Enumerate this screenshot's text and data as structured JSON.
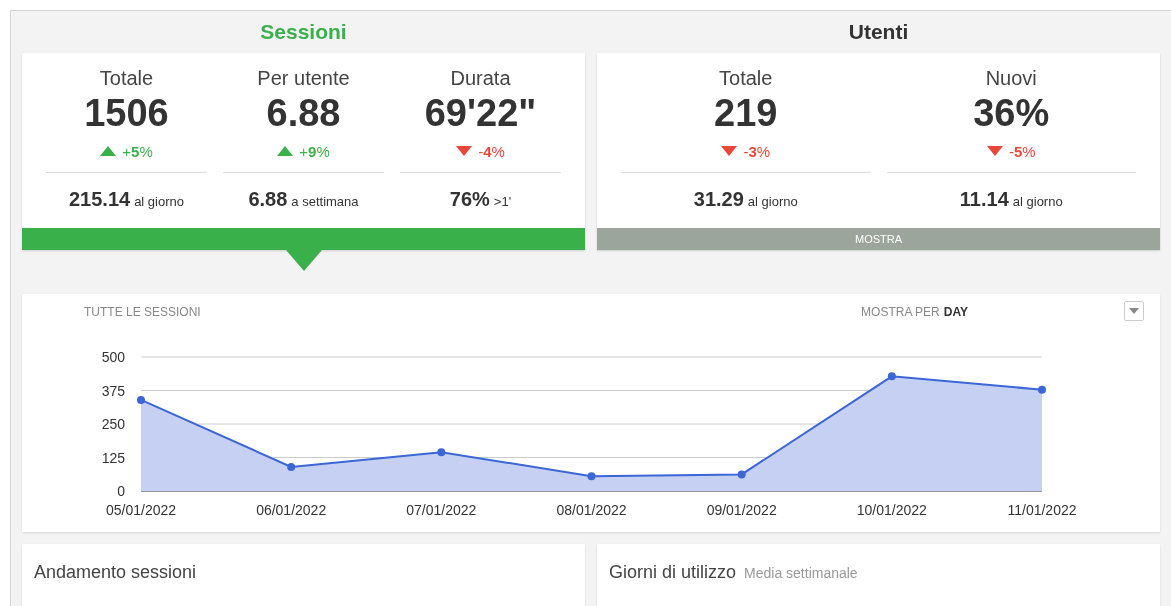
{
  "groups": [
    {
      "title": "Sessioni",
      "selected": true,
      "metrics": [
        {
          "label": "Totale",
          "value": "1506",
          "rising": true,
          "delta": "+**5**%",
          "sub_value": "215.14",
          "sub_label": "al giorno"
        },
        {
          "label": "Per utente",
          "value": "6.88",
          "rising": true,
          "delta": "+**9**%",
          "sub_value": "6.88",
          "sub_label": "a settimana"
        },
        {
          "label": "Durata",
          "value": "69'22\"",
          "rising": false,
          "delta": "-**4**%",
          "sub_value": "76%",
          "sub_label": ">1'"
        }
      ]
    },
    {
      "title": "Utenti",
      "selected": false,
      "footer": "MOSTRA",
      "metrics": [
        {
          "label": "Totale",
          "value": "219",
          "rising": false,
          "delta": "-**3**%",
          "sub_value": "31.29",
          "sub_label": "al giorno"
        },
        {
          "label": "Nuovi",
          "value": "36%",
          "rising": false,
          "delta": "-**5**%",
          "sub_value": "11.14",
          "sub_label": "al giorno"
        }
      ]
    }
  ],
  "chart_section": {
    "title": "TUTTE LE SESSIONI",
    "group_by_label": "MOSTRA PER",
    "group_by_value": "DAY",
    "chart_data": {
      "type": "area",
      "categories": [
        "05/01/2022",
        "06/01/2022",
        "07/01/2022",
        "08/01/2022",
        "09/01/2022",
        "10/01/2022",
        "11/01/2022"
      ],
      "values": [
        340,
        90,
        145,
        55,
        62,
        428,
        378
      ],
      "grid": true,
      "ylim": [
        0,
        500
      ],
      "yticks": [
        0,
        125,
        250,
        375,
        500
      ]
    }
  },
  "panels": [
    {
      "title": "Andamento sessioni"
    },
    {
      "title": "Giorni di utilizzo",
      "subtitle": "Media settimanale"
    }
  ]
}
